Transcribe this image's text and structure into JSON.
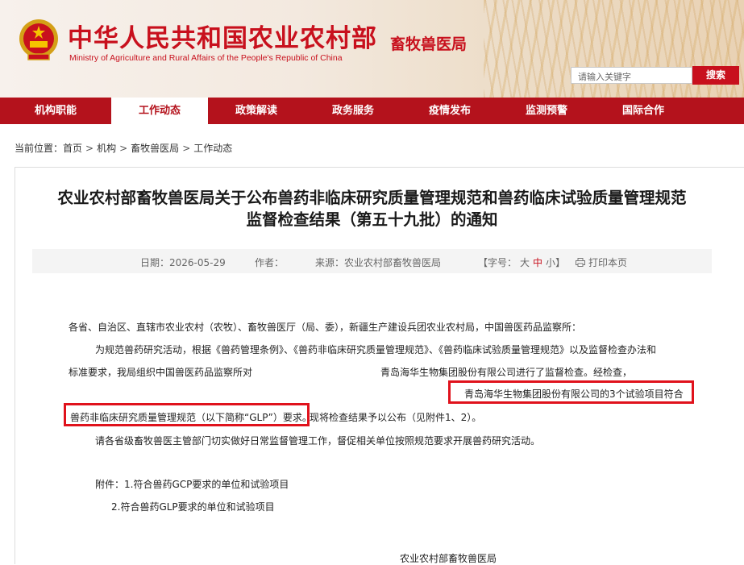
{
  "header": {
    "site_title": "中华人民共和国农业农村部",
    "site_title_en": "Ministry of Agriculture and Rural Affairs of the People's Republic of China",
    "bureau_name": "畜牧兽医局",
    "search_placeholder": "请输入关键字",
    "search_button": "搜索"
  },
  "nav": {
    "items": [
      {
        "label": "机构职能"
      },
      {
        "label": "工作动态"
      },
      {
        "label": "政策解读"
      },
      {
        "label": "政务服务"
      },
      {
        "label": "疫情发布"
      },
      {
        "label": "监测预警"
      },
      {
        "label": "国际合作"
      }
    ],
    "active_index": 1
  },
  "breadcrumb": {
    "prefix": "当前位置：",
    "items": [
      "首页",
      "机构",
      "畜牧兽医局",
      "工作动态"
    ],
    "separator": ">"
  },
  "article": {
    "title_line1": "农业农村部畜牧兽医局关于公布兽药非临床研究质量管理规范和兽药临床试验质量管理规范",
    "title_line2": "监督检查结果（第五十九批）的通知",
    "meta": {
      "date": "日期：2026-05-29",
      "author": "作者：",
      "source": "来源：农业农村部畜牧兽医局",
      "font_size_label": "【字号：",
      "font_large": "大",
      "font_medium": "中",
      "font_small": "小",
      "font_close": "】",
      "print": "打印本页"
    },
    "para_salutation": "各省、自治区、直辖市农业农村（农牧）、畜牧兽医厅（局、委），新疆生产建设兵团农业农村局，中国兽医药品监察所：",
    "para1_line1": "为规范兽药研究活动，根据《兽药管理条例》、《兽药非临床研究质量管理规范》、《兽药临床试验质量管理规范》以及监督检查办法和",
    "para1_line2a": "标准要求，我局组织中国兽医药品监察所对",
    "para1_line2b": "青岛海华生物集团股份有限公司进行了监督检查。经检查，",
    "para1_line3": "青岛海华生物集团股份有限公司的3个试验项目符合",
    "para1_line4a": "兽药非临床研究质量管理规范（以下简称“GLP”）要求。",
    "para1_line4b": "现将检查结果予以公布（见附件1、2）。",
    "para2": "请各省级畜牧兽医主管部门切实做好日常监督管理工作，督促相关单位按照规范要求开展兽药研究活动。",
    "attachment1": "附件：1.符合兽药GCP要求的单位和试验项目",
    "attachment2": "2.符合兽药GLP要求的单位和试验项目",
    "signature": "农业农村部畜牧兽医局"
  },
  "colors": {
    "brand_red": "#c8101d",
    "nav_red": "#b4121c",
    "highlight_red": "#e0121c"
  }
}
